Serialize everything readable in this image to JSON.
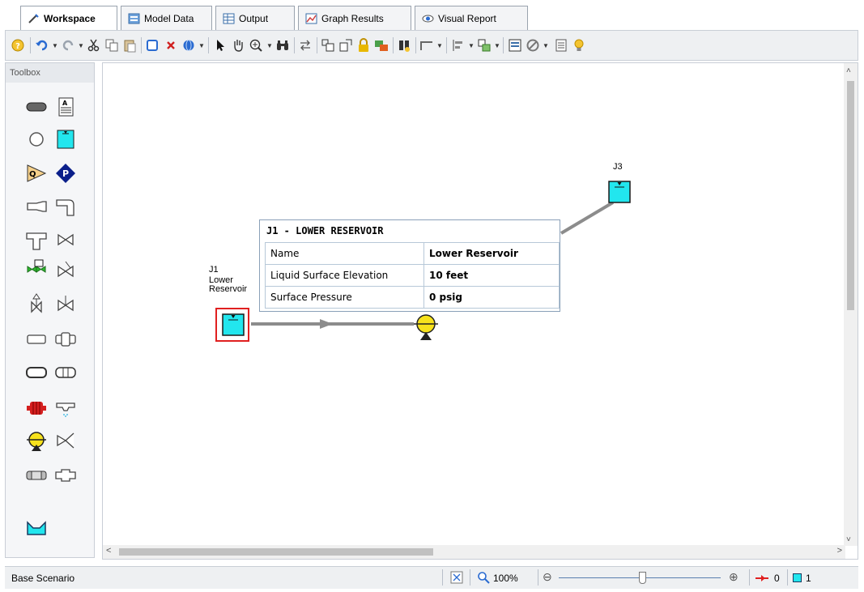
{
  "tabs": [
    {
      "label": "Workspace",
      "active": true,
      "icon": "workspace-icon"
    },
    {
      "label": "Model Data",
      "icon": "model-data-icon"
    },
    {
      "label": "Output",
      "icon": "output-icon"
    },
    {
      "label": "Graph Results",
      "icon": "graph-icon"
    },
    {
      "label": "Visual Report",
      "icon": "eye-icon"
    }
  ],
  "toolbox": {
    "title": "Toolbox"
  },
  "canvas": {
    "nodes": [
      {
        "id": "J1",
        "line1": "J1",
        "line2": "Lower",
        "line3": "Reservoir"
      },
      {
        "id": "J3",
        "line1": "J3"
      }
    ],
    "tooltip": {
      "title": "J1 - LOWER RESERVOIR",
      "rows": [
        {
          "label": "Name",
          "value": "Lower Reservoir"
        },
        {
          "label": "Liquid Surface Elevation",
          "value": "10 feet"
        },
        {
          "label": "Surface Pressure",
          "value": "0 psig"
        }
      ]
    }
  },
  "status": {
    "scenario": "Base Scenario",
    "zoom": "100%",
    "pipe_count": "0",
    "junction_count": "1"
  },
  "colors": {
    "reservoir": "#22e6ee",
    "pump": "#f7e21c",
    "selection": "#e02020",
    "pipe": "#8c8c8c"
  }
}
